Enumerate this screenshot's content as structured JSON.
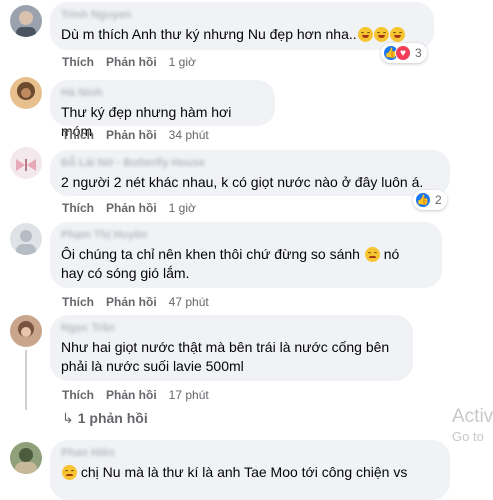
{
  "comments": [
    {
      "author": "Trinh Nguyen",
      "text": "Dù m thích Anh thư ký nhưng Nu đẹp hơn nha..",
      "emojis": 3,
      "like_label": "Thích",
      "reply_label": "Phản hồi",
      "time": "1 giờ",
      "reaction_count": "3",
      "reactions": [
        "like-icon",
        "love-icon"
      ]
    },
    {
      "author": "Hà Ninh",
      "text": "Thư ký đẹp nhưng hàm hơi móm",
      "like_label": "Thích",
      "reply_label": "Phản hồi",
      "time": "34 phút"
    },
    {
      "author": "Đỗ Lài Nở · Butterfly House",
      "text": "2 người 2 nét khác nhau, k có giọt nước nào ở đây luôn á.",
      "like_label": "Thích",
      "reply_label": "Phản hồi",
      "time": "1 giờ",
      "reaction_count": "2",
      "reactions": [
        "like-icon"
      ]
    },
    {
      "author": "Phạm Thị Huyền",
      "text_line1": "Ôi chúng ta chỉ nên khen thôi chứ đừng so sánh",
      "text_line1_end": "nó",
      "text_line2": "hay có sóng gió lắm.",
      "like_label": "Thích",
      "reply_label": "Phản hồi",
      "time": "47 phút"
    },
    {
      "author": "Ngọc Trần",
      "text_line1": "Như hai giọt nước thật mà bên trái là nước cống bên",
      "text_line2": "phải là nước suối lavie 500ml",
      "like_label": "Thích",
      "reply_label": "Phản hồi",
      "time": "17 phút",
      "replies_label": "1 phản hồi"
    },
    {
      "author": "Phan Hiền",
      "text": "chị Nu mà là thư kí là anh Tae Moo tới công chiện vs"
    }
  ],
  "watermark": {
    "line1": "Activ",
    "line2": "Go to"
  }
}
